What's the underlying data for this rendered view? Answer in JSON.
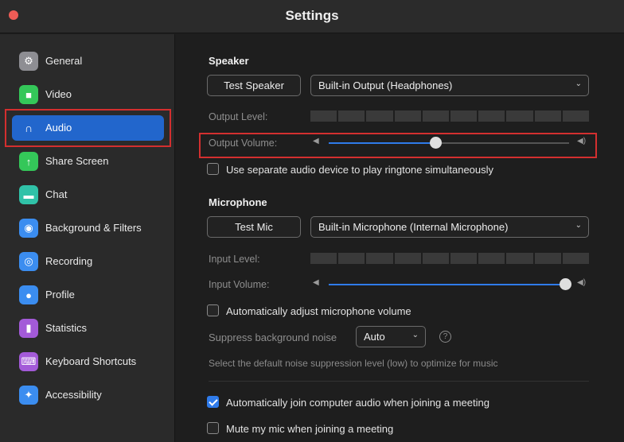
{
  "window": {
    "title": "Settings"
  },
  "sidebar": {
    "items": [
      {
        "label": "General",
        "icon": "gear-icon",
        "color": "#8e8e93",
        "glyph": "⚙"
      },
      {
        "label": "Video",
        "icon": "video-camera-icon",
        "color": "#34c759",
        "glyph": "■"
      },
      {
        "label": "Audio",
        "icon": "headphones-icon",
        "color": "",
        "glyph": "🎧"
      },
      {
        "label": "Share Screen",
        "icon": "share-screen-icon",
        "color": "#34c759",
        "glyph": "↑"
      },
      {
        "label": "Chat",
        "icon": "chat-bubble-icon",
        "color": "#30c2a8",
        "glyph": "▬"
      },
      {
        "label": "Background & Filters",
        "icon": "background-icon",
        "color": "#3b8df0",
        "glyph": "◉"
      },
      {
        "label": "Recording",
        "icon": "recording-icon",
        "color": "#3b8df0",
        "glyph": "◎"
      },
      {
        "label": "Profile",
        "icon": "profile-icon",
        "color": "#3b8df0",
        "glyph": "●"
      },
      {
        "label": "Statistics",
        "icon": "statistics-icon",
        "color": "#a35ad8",
        "glyph": "▮"
      },
      {
        "label": "Keyboard Shortcuts",
        "icon": "keyboard-icon",
        "color": "#a35ad8",
        "glyph": "⌨"
      },
      {
        "label": "Accessibility",
        "icon": "accessibility-icon",
        "color": "#3b8df0",
        "glyph": "✦"
      }
    ],
    "active_index": 2,
    "accent": "#2266cc"
  },
  "speaker": {
    "title": "Speaker",
    "test_button": "Test Speaker",
    "device": "Built-in Output (Headphones)",
    "output_level_label": "Output Level:",
    "output_volume_label": "Output Volume:",
    "output_volume_fraction": 0.445,
    "separate_device_label": "Use separate audio device to play ringtone simultaneously",
    "separate_device_checked": false
  },
  "microphone": {
    "title": "Microphone",
    "test_button": "Test Mic",
    "device": "Built-in Microphone (Internal Microphone)",
    "input_level_label": "Input Level:",
    "input_volume_label": "Input Volume:",
    "input_volume_fraction": 0.985,
    "auto_adjust_label": "Automatically adjust microphone volume",
    "auto_adjust_checked": false,
    "suppress_label": "Suppress background noise",
    "suppress_value": "Auto",
    "suppress_hint": "Select the default noise suppression level (low) to optimize for music"
  },
  "options": {
    "auto_join_label": "Automatically join computer audio when joining a meeting",
    "auto_join_checked": true,
    "mute_label": "Mute my mic when joining a meeting",
    "mute_checked": false
  },
  "colors": {
    "highlight": "#d32f2f",
    "slider_fill": "#2f7bea"
  }
}
